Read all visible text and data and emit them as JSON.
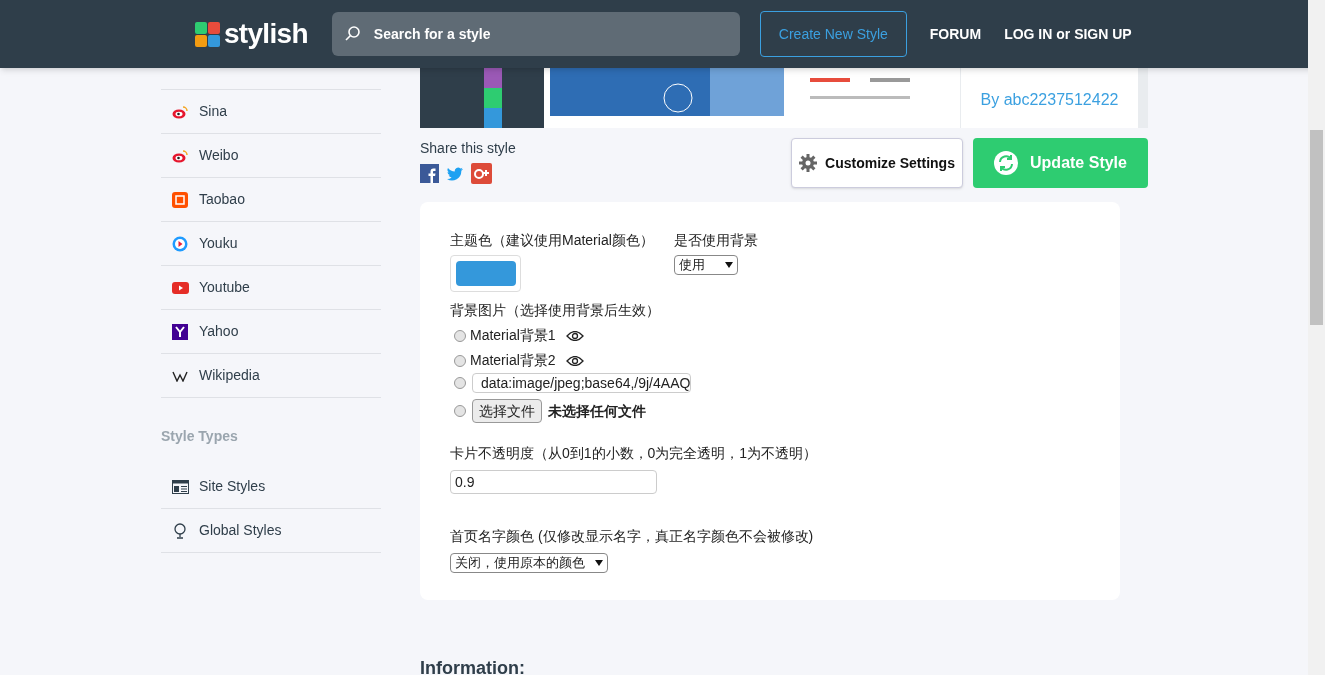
{
  "header": {
    "logo": "stylish",
    "search": {
      "placeholder": "Search for a style"
    },
    "create_button": "Create New Style",
    "links": [
      "FORUM",
      "LOG IN or SIGN UP"
    ]
  },
  "sidebar": {
    "items": [
      {
        "label": "Sina"
      },
      {
        "label": "Weibo"
      },
      {
        "label": "Taobao"
      },
      {
        "label": "Youku"
      },
      {
        "label": "Youtube"
      },
      {
        "label": "Yahoo"
      },
      {
        "label": "Wikipedia"
      }
    ],
    "style_types": {
      "title": "Style Types",
      "items": [
        {
          "label": "Site Styles"
        },
        {
          "label": "Global Styles"
        }
      ]
    }
  },
  "preview": {
    "author": "By abc2237512422"
  },
  "share": {
    "label": "Share this style"
  },
  "buttons": {
    "customize": "Customize Settings",
    "update": "Update Style"
  },
  "settings": {
    "theme_color": {
      "label": "主题色（建议使用Material颜色）",
      "color": "#3498db"
    },
    "use_background": {
      "label": "是否使用背景",
      "value": "使用"
    },
    "background_image": {
      "label": "背景图片（选择使用背景后生效）",
      "options": [
        {
          "kind": "preset",
          "label": "Material背景1",
          "selected": false
        },
        {
          "kind": "preset",
          "label": "Material背景2",
          "selected": false
        },
        {
          "kind": "url",
          "value": "data:image/jpeg;base64,/9j/4AAQ",
          "selected": false
        },
        {
          "kind": "file",
          "button": "选择文件",
          "status": "未选择任何文件",
          "selected": false
        }
      ]
    },
    "opacity": {
      "label": "卡片不透明度（从0到1的小数，0为完全透明，1为不透明）",
      "value": "0.9"
    },
    "name_color": {
      "label": "首页名字颜色 (仅修改显示名字，真正名字颜色不会被修改)",
      "value": "关闭，使用原本的颜色"
    }
  },
  "information": {
    "title": "Information:"
  }
}
